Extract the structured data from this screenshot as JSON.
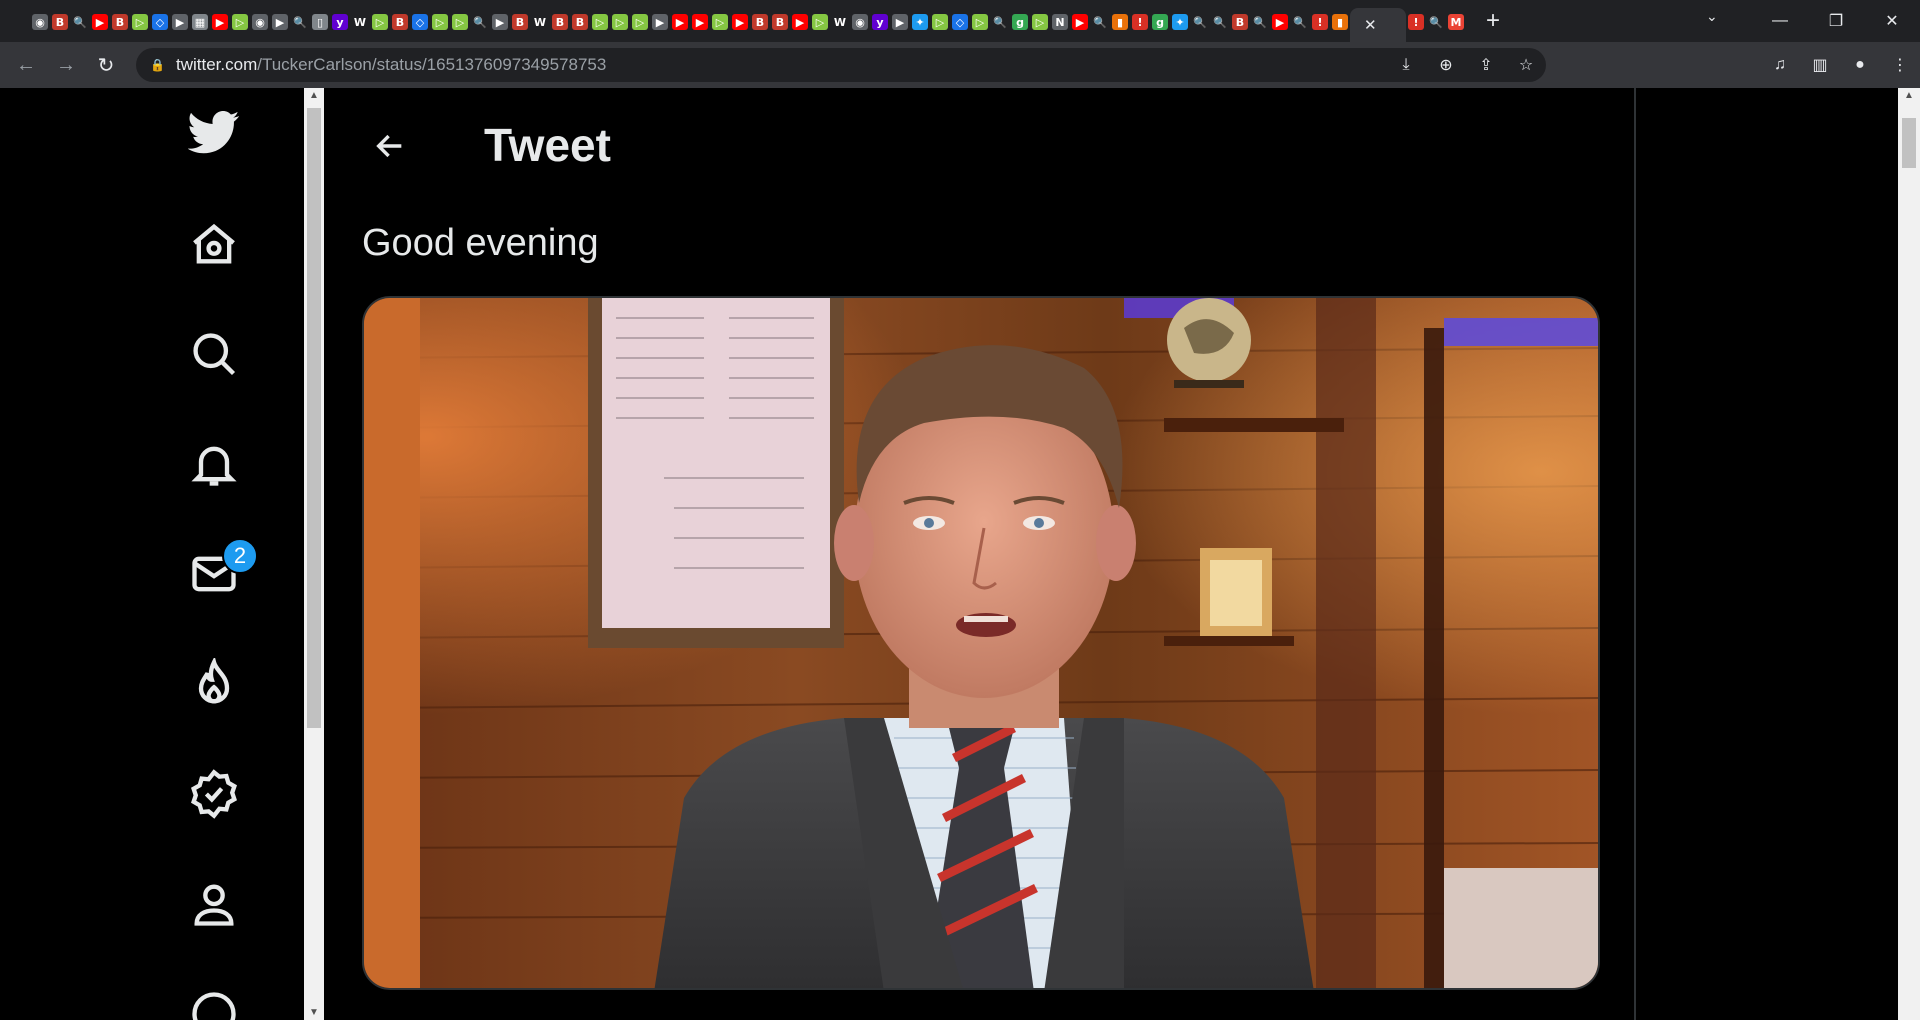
{
  "browser": {
    "tabs": [
      {
        "icon": "globe-icon",
        "color": "#5f6368",
        "glyph": "◉"
      },
      {
        "icon": "b-icon",
        "color": "#c0392b",
        "glyph": "B"
      },
      {
        "icon": "search-icon",
        "color": "#202124",
        "glyph": "🔍"
      },
      {
        "icon": "youtube-icon",
        "color": "#ff0000",
        "glyph": "▶"
      },
      {
        "icon": "b-icon",
        "color": "#c0392b",
        "glyph": "B"
      },
      {
        "icon": "rumble-icon",
        "color": "#85c742",
        "glyph": "▷"
      },
      {
        "icon": "shield-icon",
        "color": "#1a73e8",
        "glyph": "◇"
      },
      {
        "icon": "bookmark-icon",
        "color": "#5f6368",
        "glyph": "▶"
      },
      {
        "icon": "grid-icon",
        "color": "#80868b",
        "glyph": "▦"
      },
      {
        "icon": "youtube-icon",
        "color": "#ff0000",
        "glyph": "▶"
      },
      {
        "icon": "rumble-icon",
        "color": "#85c742",
        "glyph": "▷"
      },
      {
        "icon": "globe-icon",
        "color": "#5f6368",
        "glyph": "◉"
      },
      {
        "icon": "bookmark-icon",
        "color": "#5f6368",
        "glyph": "▶"
      },
      {
        "icon": "search-icon",
        "color": "#202124",
        "glyph": "🔍"
      },
      {
        "icon": "doc-icon",
        "color": "#80868b",
        "glyph": "▯"
      },
      {
        "icon": "yahoo-icon",
        "color": "#6001d2",
        "glyph": "y"
      },
      {
        "icon": "wsj-icon",
        "color": "#202124",
        "glyph": "W"
      },
      {
        "icon": "rumble-icon",
        "color": "#85c742",
        "glyph": "▷"
      },
      {
        "icon": "b-icon",
        "color": "#c0392b",
        "glyph": "B"
      },
      {
        "icon": "shield-icon",
        "color": "#1a73e8",
        "glyph": "◇"
      },
      {
        "icon": "rumble-icon",
        "color": "#85c742",
        "glyph": "▷"
      },
      {
        "icon": "rumble-icon",
        "color": "#85c742",
        "glyph": "▷"
      },
      {
        "icon": "search-icon",
        "color": "#202124",
        "glyph": "🔍"
      },
      {
        "icon": "bookmark-icon",
        "color": "#5f6368",
        "glyph": "▶"
      },
      {
        "icon": "b-icon",
        "color": "#c0392b",
        "glyph": "B"
      },
      {
        "icon": "wsj-icon",
        "color": "#202124",
        "glyph": "W"
      },
      {
        "icon": "b-icon",
        "color": "#c0392b",
        "glyph": "B"
      },
      {
        "icon": "b-icon",
        "color": "#c0392b",
        "glyph": "B"
      },
      {
        "icon": "rumble-icon",
        "color": "#85c742",
        "glyph": "▷"
      },
      {
        "icon": "rumble-icon",
        "color": "#85c742",
        "glyph": "▷"
      },
      {
        "icon": "rumble-icon",
        "color": "#85c742",
        "glyph": "▷"
      },
      {
        "icon": "bookmark-icon",
        "color": "#5f6368",
        "glyph": "▶"
      },
      {
        "icon": "youtube-icon",
        "color": "#ff0000",
        "glyph": "▶"
      },
      {
        "icon": "youtube-icon",
        "color": "#ff0000",
        "glyph": "▶"
      },
      {
        "icon": "rumble-icon",
        "color": "#85c742",
        "glyph": "▷"
      },
      {
        "icon": "youtube-icon",
        "color": "#ff0000",
        "glyph": "▶"
      },
      {
        "icon": "b-icon",
        "color": "#c0392b",
        "glyph": "B"
      },
      {
        "icon": "b-icon",
        "color": "#c0392b",
        "glyph": "B"
      },
      {
        "icon": "youtube-icon",
        "color": "#ff0000",
        "glyph": "▶"
      },
      {
        "icon": "rumble-icon",
        "color": "#85c742",
        "glyph": "▷"
      },
      {
        "icon": "wsj-icon",
        "color": "#202124",
        "glyph": "W"
      },
      {
        "icon": "globe-icon",
        "color": "#5f6368",
        "glyph": "◉"
      },
      {
        "icon": "yahoo-icon",
        "color": "#6001d2",
        "glyph": "y"
      },
      {
        "icon": "bookmark-icon",
        "color": "#5f6368",
        "glyph": "▶"
      },
      {
        "icon": "twitter-icon",
        "color": "#1d9bf0",
        "glyph": "✦"
      },
      {
        "icon": "rumble-icon",
        "color": "#85c742",
        "glyph": "▷"
      },
      {
        "icon": "shield-icon",
        "color": "#1a73e8",
        "glyph": "◇"
      },
      {
        "icon": "rumble-icon",
        "color": "#85c742",
        "glyph": "▷"
      },
      {
        "icon": "search-icon",
        "color": "#202124",
        "glyph": "🔍"
      },
      {
        "icon": "g-icon",
        "color": "#34a853",
        "glyph": "g"
      },
      {
        "icon": "rumble-icon",
        "color": "#85c742",
        "glyph": "▷"
      },
      {
        "icon": "news-icon",
        "color": "#5f6368",
        "glyph": "N"
      },
      {
        "icon": "youtube-icon",
        "color": "#ff0000",
        "glyph": "▶"
      },
      {
        "icon": "search-icon",
        "color": "#202124",
        "glyph": "🔍"
      },
      {
        "icon": "bookmark-red-icon",
        "color": "#e8710a",
        "glyph": "▮"
      },
      {
        "icon": "alert-icon",
        "color": "#d93025",
        "glyph": "!"
      },
      {
        "icon": "g-icon",
        "color": "#34a853",
        "glyph": "g"
      },
      {
        "icon": "twitter-icon",
        "color": "#1d9bf0",
        "glyph": "✦"
      },
      {
        "icon": "search-icon",
        "color": "#202124",
        "glyph": "🔍"
      },
      {
        "icon": "search-icon",
        "color": "#202124",
        "glyph": "🔍"
      },
      {
        "icon": "b-icon",
        "color": "#c0392b",
        "glyph": "B"
      },
      {
        "icon": "search-icon",
        "color": "#202124",
        "glyph": "🔍"
      },
      {
        "icon": "youtube-icon",
        "color": "#ff0000",
        "glyph": "▶"
      },
      {
        "icon": "search-icon",
        "color": "#202124",
        "glyph": "🔍"
      },
      {
        "icon": "alert-icon",
        "color": "#d93025",
        "glyph": "!"
      },
      {
        "icon": "bookmark-red-icon",
        "color": "#e8710a",
        "glyph": "▮"
      }
    ],
    "active_tab_close": "✕",
    "after_tabs": [
      {
        "icon": "alert-icon",
        "color": "#d93025",
        "glyph": "!"
      },
      {
        "icon": "search-icon",
        "color": "#202124",
        "glyph": "🔍"
      },
      {
        "icon": "gmail-icon",
        "color": "#ea4335",
        "glyph": "M"
      }
    ],
    "new_tab": "+",
    "url_host": "twitter.com",
    "url_path": "/TuckerCarlson/status/1651376097349578753"
  },
  "page": {
    "header_title": "Tweet",
    "tweet_text": "Good evening",
    "messages_badge": "2",
    "colors": {
      "accent": "#1d9bf0",
      "background": "#000000",
      "text": "#e7e9ea",
      "border": "#2f3336"
    }
  }
}
